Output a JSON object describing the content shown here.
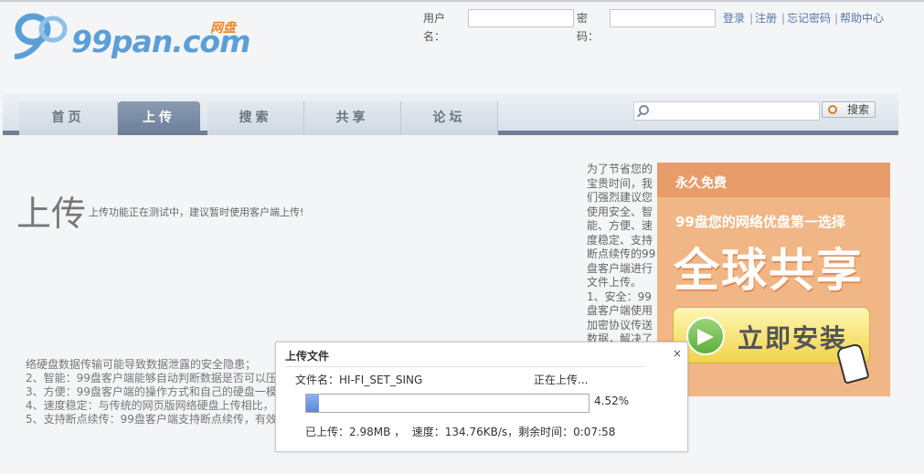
{
  "logo": {
    "text": "99pan.com",
    "sub": "网盘"
  },
  "login": {
    "username_label": "用户名：",
    "password_label": "密码：",
    "links": [
      "登录",
      "注册",
      "忘记密码",
      "帮助中心"
    ]
  },
  "nav": {
    "tabs": [
      "首页",
      "上传",
      "搜索",
      "共享",
      "论坛"
    ],
    "active": "上传",
    "search_button": "搜索"
  },
  "page": {
    "title": "上传",
    "note": "上传功能正在测试中，建议暂时使用客户端上传!"
  },
  "side_text": "为了节省您的宝贵时间，我们强烈建议您使用安全、智能、方便、速度稳定、支持断点续传的99盘客户端进行文件上传。1、安全：99盘客户端使用加密协议传送数据，解决了",
  "features": [
    "络硬盘数据传输可能导致数据泄露的安全隐患；",
    "2、智能：99盘客户端能够自动判断数据是否可以压",
    "3、方便：99盘客户端的操作方式和自己的硬盘一模",
    "4、速度稳定：与传统的网页版网络硬盘上传相比，",
    "5、支持断点续传：99盘客户端支持断点续传，有效"
  ],
  "banner": {
    "tag": "永久免费",
    "line1": "99盘您的网络优盘第一选择",
    "big": "全球共享",
    "button": "立即安装",
    "colors": {
      "bg": "#f1b685",
      "top": "#e89c6a"
    }
  },
  "dialog": {
    "title": "上传文件",
    "close": "×",
    "filename_label": "文件名：",
    "filename": "HI-FI_SET_SING",
    "status": "正在上传...",
    "progress_pct": 4.52,
    "progress_text": "4.52%",
    "stats": "已上传：2.98MB ，  速度：134.76KB/s，剩余时间：0:07:58"
  }
}
